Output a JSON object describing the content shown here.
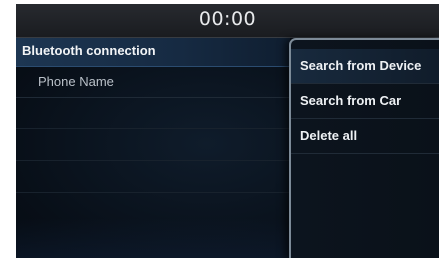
{
  "status_bar": {
    "clock": "00:00"
  },
  "bluetooth": {
    "title": "Bluetooth connection",
    "devices": [
      {
        "name": "Phone Name"
      }
    ]
  },
  "menu": {
    "items": [
      {
        "label": "Search from Device"
      },
      {
        "label": "Search from Car"
      },
      {
        "label": "Delete all"
      }
    ]
  },
  "colors": {
    "background": "#080f18",
    "header_highlight": "#1d3652",
    "menu_border": "#7d8b98",
    "text_primary": "#eef1f4",
    "text_secondary": "#b9c0c8"
  }
}
